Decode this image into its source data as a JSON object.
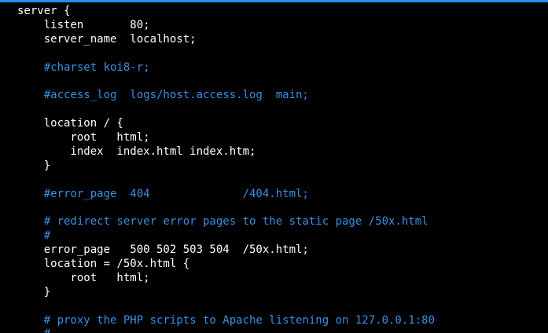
{
  "terminal": {
    "colors": {
      "background": "#000000",
      "text": "#ffffff",
      "comment": "#3a8fe6",
      "top_strip": "#1e90ff"
    },
    "lines": [
      {
        "text": "server {",
        "type": "code"
      },
      {
        "text": "    listen       80;",
        "type": "code"
      },
      {
        "text": "    server_name  localhost;",
        "type": "code"
      },
      {
        "text": "",
        "type": "blank"
      },
      {
        "text": "    #charset koi8-r;",
        "type": "comment"
      },
      {
        "text": "",
        "type": "blank"
      },
      {
        "text": "    #access_log  logs/host.access.log  main;",
        "type": "comment"
      },
      {
        "text": "",
        "type": "blank"
      },
      {
        "text": "    location / {",
        "type": "code"
      },
      {
        "text": "        root   html;",
        "type": "code"
      },
      {
        "text": "        index  index.html index.htm;",
        "type": "code"
      },
      {
        "text": "    }",
        "type": "code"
      },
      {
        "text": "",
        "type": "blank"
      },
      {
        "text": "    #error_page  404              /404.html;",
        "type": "comment"
      },
      {
        "text": "",
        "type": "blank"
      },
      {
        "text": "    # redirect server error pages to the static page /50x.html",
        "type": "comment"
      },
      {
        "text": "    #",
        "type": "comment"
      },
      {
        "text": "    error_page   500 502 503 504  /50x.html;",
        "type": "code"
      },
      {
        "text": "    location = /50x.html {",
        "type": "code"
      },
      {
        "text": "        root   html;",
        "type": "code"
      },
      {
        "text": "    }",
        "type": "code"
      },
      {
        "text": "",
        "type": "blank"
      },
      {
        "text": "    # proxy the PHP scripts to Apache listening on 127.0.0.1:80",
        "type": "comment"
      },
      {
        "text": "    #",
        "type": "comment"
      }
    ]
  }
}
